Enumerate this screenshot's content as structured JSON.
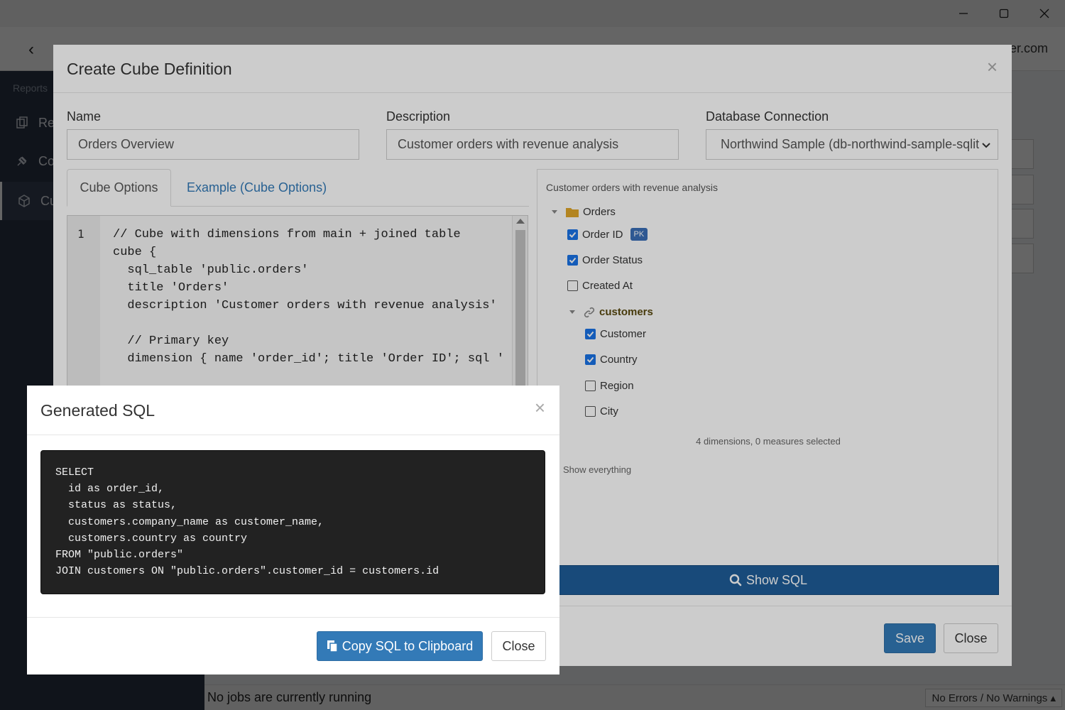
{
  "window": {
    "minimize_glyph": "—",
    "maximize_glyph": "☐",
    "close_glyph": "✕"
  },
  "app": {
    "email_fragment": "er.com",
    "sidebar": {
      "heading": "Reports",
      "items": [
        {
          "label": "Re",
          "icon": "reports-icon"
        },
        {
          "label": "Co",
          "icon": "plug-icon"
        },
        {
          "label": "Cu",
          "icon": "cube-icon"
        }
      ]
    },
    "status": {
      "jobs": "No jobs are currently running",
      "errors": "No Errors / No Warnings ▴"
    }
  },
  "cube_modal": {
    "title": "Create Cube Definition",
    "name_label": "Name",
    "name_value": "Orders Overview",
    "description_label": "Description",
    "description_value": "Customer orders with revenue analysis",
    "connection_label": "Database Connection",
    "connection_value": "Northwind Sample (db-northwind-sample-sqlit",
    "tabs": {
      "active": "Cube Options",
      "other": "Example (Cube Options)"
    },
    "editor": {
      "line_number": "1",
      "code": "// Cube with dimensions from main + joined table\ncube {\n  sql_table 'public.orders'\n  title 'Orders'\n  description 'Customer orders with revenue analysis'\n\n  // Primary key\n  dimension { name 'order_id'; title 'Order ID'; sql '"
    },
    "tree": {
      "description": "Customer orders with revenue analysis",
      "root": "Orders",
      "fields": [
        {
          "label": "Order ID",
          "checked": true,
          "badge": "PK"
        },
        {
          "label": "Order Status",
          "checked": true
        },
        {
          "label": "Created At",
          "checked": false
        }
      ],
      "join": "customers",
      "join_fields": [
        {
          "label": "Customer",
          "checked": true
        },
        {
          "label": "Country",
          "checked": true
        },
        {
          "label": "Region",
          "checked": false
        },
        {
          "label": "City",
          "checked": false
        }
      ],
      "summary": "4 dimensions, 0 measures selected",
      "show_everything": "Show everything"
    },
    "show_sql_label": "Show SQL",
    "save_label": "Save",
    "close_label": "Close"
  },
  "sql_modal": {
    "title": "Generated SQL",
    "sql": "SELECT\n  id as order_id,\n  status as status,\n  customers.company_name as customer_name,\n  customers.country as country\nFROM \"public.orders\"\nJOIN customers ON \"public.orders\".customer_id = customers.id",
    "copy_label": "Copy SQL to Clipboard",
    "close_label": "Close"
  },
  "colors": {
    "primary": "#337ab7",
    "show_sql": "#1f5d99",
    "code_bg": "#222222",
    "sidebar": "#2b3444",
    "checkbox": "#1a73e8"
  }
}
